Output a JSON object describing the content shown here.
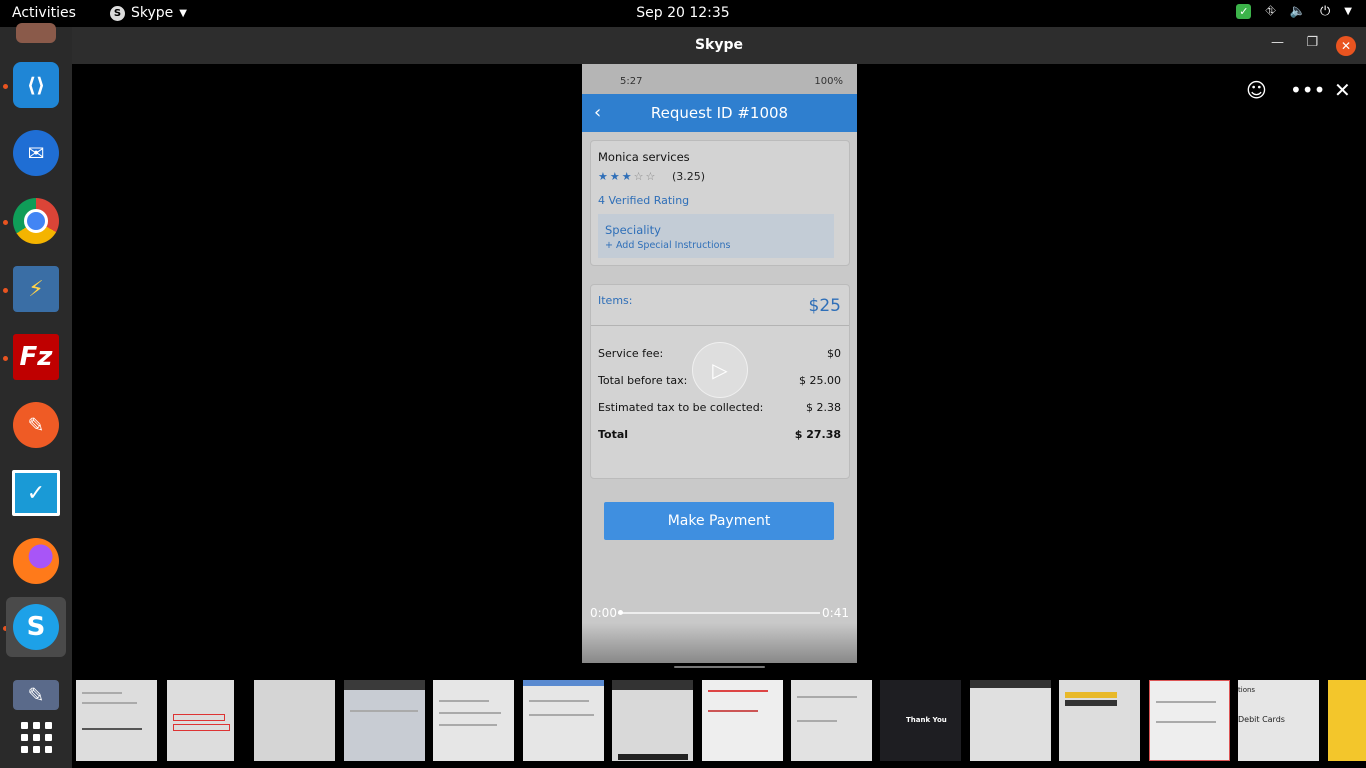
{
  "topbar": {
    "activities": "Activities",
    "app_name": "Skype",
    "clock": "Sep 20  12:35"
  },
  "window": {
    "title": "Skype"
  },
  "phone": {
    "status_time": "5:27",
    "status_battery": "100%",
    "header_title": "Request ID #1008",
    "provider": {
      "name": "Monica services",
      "rating_value": "(3.25)",
      "stars_filled": 3,
      "stars_total": 5,
      "verified": "4 Verified Rating",
      "speciality_label": "Speciality",
      "add_instructions": "+ Add Special Instructions"
    },
    "summary": {
      "items_label": "Items:",
      "items_amount": "$25",
      "service_fee_label": "Service fee:",
      "service_fee_value": "$0",
      "total_before_tax_label": "Total before tax:",
      "total_before_tax_value": "$ 25.00",
      "tax_label": "Estimated tax to be collected:",
      "tax_value": "$ 2.38",
      "total_label": "Total",
      "total_value": "$ 27.38"
    },
    "pay_button": "Make Payment",
    "video": {
      "current": "0:00",
      "duration": "0:41",
      "progress": 0.0
    }
  },
  "thumbnails": {
    "thank_you": "Thank You",
    "debit_cards": "Debit Cards",
    "options": "tions"
  },
  "colors": {
    "ubuntu_orange": "#e95420",
    "phone_blue": "#2f7fcf",
    "link_blue": "#2f6fb8"
  }
}
